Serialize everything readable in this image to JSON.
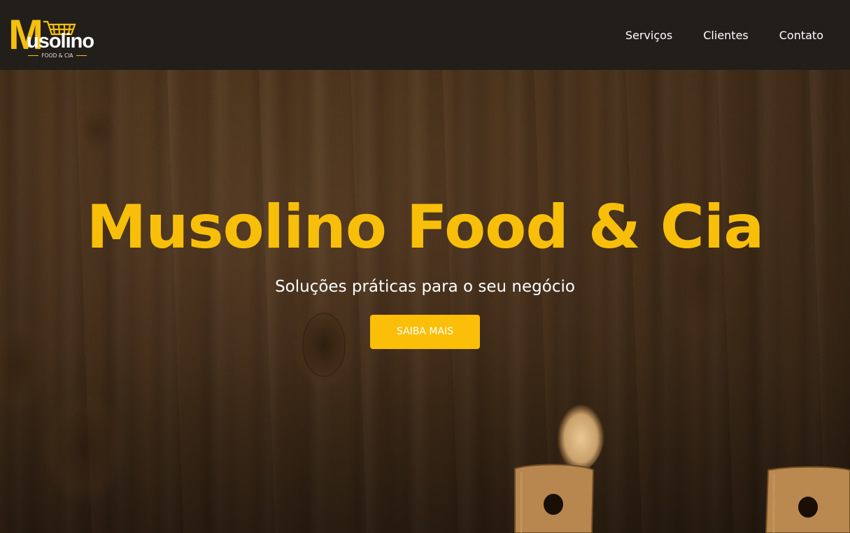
{
  "header": {
    "logo": {
      "initial": "M",
      "word": "usolino",
      "tagline": "FOOD & CIA"
    },
    "nav": [
      {
        "label": "Serviços"
      },
      {
        "label": "Clientes"
      },
      {
        "label": "Contato"
      }
    ]
  },
  "hero": {
    "title": "Musolino Food & Cia",
    "subtitle": "Soluções práticas para o seu negócio",
    "cta_label": "SAIBA MAIS"
  },
  "colors": {
    "brand_yellow": "#f8bf0a",
    "header_bg": "#221f1b",
    "wood": "#54391f"
  },
  "icons": [
    "shopping-cart-icon"
  ]
}
